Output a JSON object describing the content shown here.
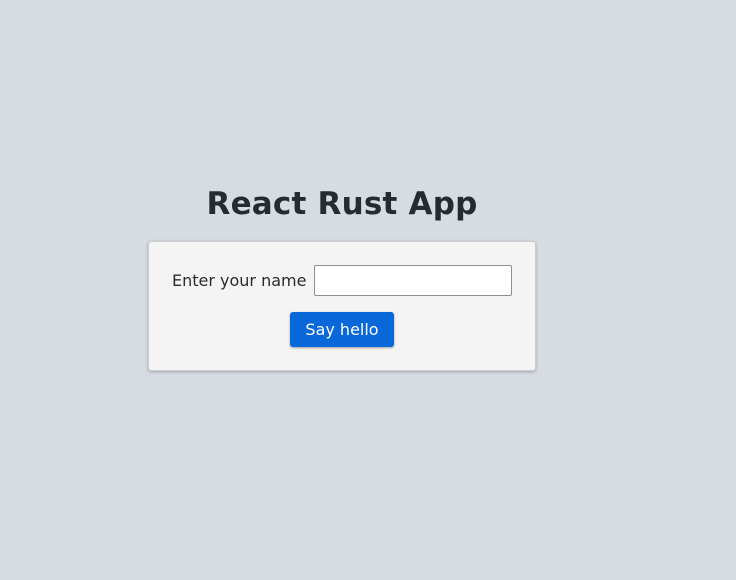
{
  "app": {
    "title": "React Rust App"
  },
  "form": {
    "name_label": "Enter your name",
    "name_value": "",
    "name_placeholder": "",
    "submit_label": "Say hello"
  },
  "colors": {
    "background": "#d6dce2",
    "card": "#f4f4f4",
    "button": "#0968d9",
    "button_text": "#ffffff",
    "title_text": "#262b30"
  }
}
